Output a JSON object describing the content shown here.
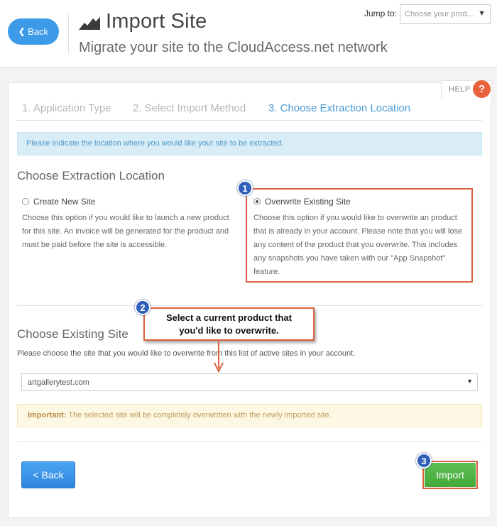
{
  "header": {
    "back_label": "Back",
    "title": "Import Site",
    "subtitle": "Migrate your site to the CloudAccess.net network",
    "jump_label": "Jump to:",
    "jump_placeholder": "Choose your prod..."
  },
  "help": {
    "label": "HELP",
    "icon_glyph": "?"
  },
  "steps": [
    {
      "label": "1. Application Type",
      "state": "inactive"
    },
    {
      "label": "2. Select Import Method",
      "state": "inactive"
    },
    {
      "label": "3. Choose Extraction Location",
      "state": "active"
    }
  ],
  "info_alert": "Please indicate the location where you would like your site to be extracted.",
  "extraction": {
    "heading": "Choose Extraction Location",
    "options": [
      {
        "label": "Create New Site",
        "checked": false,
        "desc_lines": [
          "Choose this option if you would like to launch a new product",
          "for this site. An invoice will be generated for the product and",
          "must be paid before the site is accessible."
        ]
      },
      {
        "label": "Overwrite Existing Site",
        "checked": true,
        "desc_lines": [
          "Choose this option if you would like to overwrite an product",
          "that is already in your account. Please note that you will lose",
          "any content of the product that you overwrite. This includes",
          "any snapshots you have taken with our \"App Snapshot\"",
          "feature."
        ]
      }
    ]
  },
  "existing": {
    "heading": "Choose Existing Site",
    "hint": "Please choose the site that you would like to overwrite from this list of active sites in your account.",
    "selected_site": "artgallerytest.com"
  },
  "callout": {
    "line1": "Select a current product that",
    "line2": "you'd like to overwrite."
  },
  "badges": [
    "1",
    "2",
    "3"
  ],
  "warning": {
    "strong": "Important:",
    "text": " The selected site will be completely overwritten with the newly imported site."
  },
  "footer": {
    "back_label": "Back",
    "import_label": "Import"
  },
  "colors": {
    "primary_blue": "#3d9ae8",
    "active_step": "#4a9bd6",
    "annotation_red": "#d9603f",
    "badge_blue": "#2f5fb8",
    "import_green": "#4cae42",
    "help_orange": "#e8633b"
  },
  "icons": {
    "back": "chevron-left-icon",
    "title": "signal-bars-icon",
    "help": "question-icon",
    "caret": "caret-down-icon",
    "arrow": "arrow-down-icon"
  }
}
